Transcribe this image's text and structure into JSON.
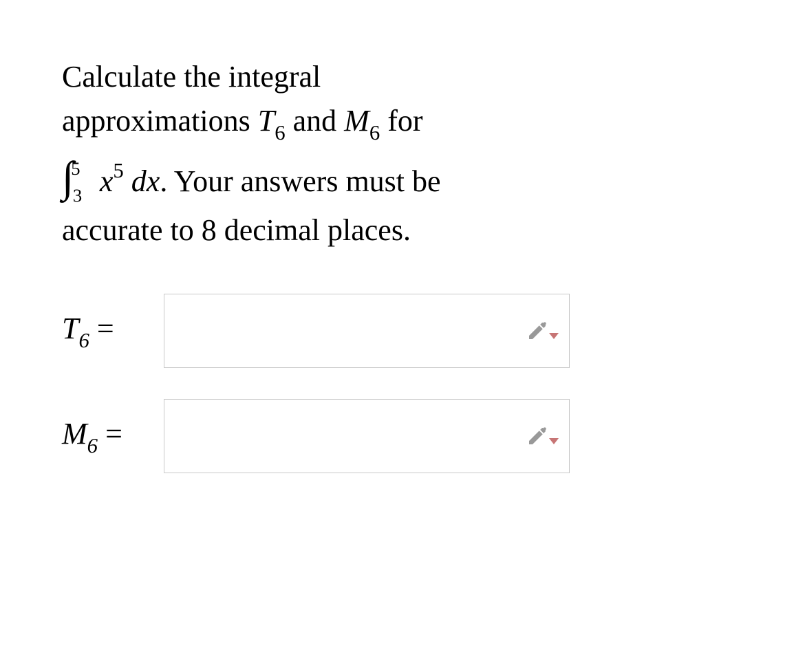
{
  "question": {
    "line1_prefix": "Calculate the integral",
    "line2_prefix": "approximations ",
    "t_var": "T",
    "t_sub": "6",
    "and_word": " and ",
    "m_var": "M",
    "m_sub": "6",
    "for_word": " for",
    "integral_symbol": "∫",
    "int_upper": "5",
    "int_lower": "3",
    "integrand_x": "x",
    "integrand_exp": "5",
    "dx": " dx",
    "period": ". ",
    "line3": "Your answers must be",
    "line4": "accurate to 8 decimal places."
  },
  "answers": {
    "t6_label_var": "T",
    "t6_label_sub": "6",
    "t6_equals": " =",
    "t6_value": "",
    "m6_label_var": "M",
    "m6_label_sub": "6",
    "m6_equals": " =",
    "m6_value": ""
  }
}
